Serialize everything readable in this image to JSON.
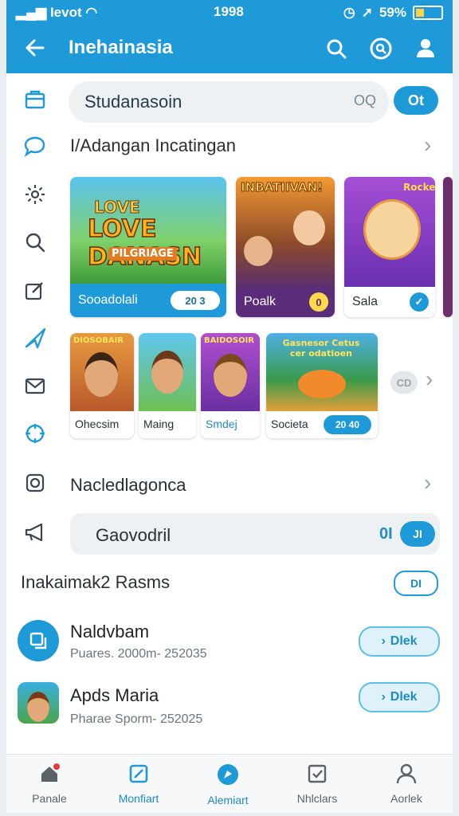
{
  "status_bar": {
    "carrier": "Ievot",
    "time": "1998",
    "battery": "59%"
  },
  "app_bar": {
    "title": "Inehainasia"
  },
  "search": {
    "value": "Studanasoin",
    "icon_text": "OQ",
    "pill_label": "Ot"
  },
  "section_1": {
    "title": "I/Adangan Incatingan"
  },
  "featured": [
    {
      "label": "Sooadolali",
      "tag": "20 3",
      "art_text": "LOVE DANASN",
      "sub_text": "PILGRIAGE"
    },
    {
      "label": "Poalk",
      "tag": "0",
      "art_text": "INBATIIVAN!"
    },
    {
      "label": "Sala",
      "tag": "",
      "art_text": "Rocke"
    }
  ],
  "games": [
    {
      "label": "Ohecsim",
      "art_text": "DIOSOBAIR"
    },
    {
      "label": "Maing",
      "art_text": ""
    },
    {
      "label": "Smdej",
      "art_text": "BAIDOSOIR"
    },
    {
      "label": "Societa",
      "tag": "20 40",
      "art_text": "Gasnesor Cetus cer odatioen"
    }
  ],
  "games_more": "CD",
  "section_2": {
    "title": "Nacledlagonca"
  },
  "section_3": {
    "value": "Gaovodril",
    "right_text": "0I",
    "pill_label": "JI"
  },
  "recent": {
    "title": "Inakaimak2 Rasms",
    "pill_label": "DI"
  },
  "list_items": [
    {
      "title": "Naldvbam",
      "subtitle": "Puares. 2000m- 252035",
      "button": "Dlek"
    },
    {
      "title": "Apds Maria",
      "subtitle": "Pharae Sporm- 252025",
      "button": "Dlek"
    }
  ],
  "bottom_nav": [
    {
      "label": "Panale",
      "active": false
    },
    {
      "label": "Monfiart",
      "active": true
    },
    {
      "label": "Alemiart",
      "active": true
    },
    {
      "label": "Nhlclars",
      "active": false
    },
    {
      "label": "Aorlek",
      "active": false
    }
  ]
}
